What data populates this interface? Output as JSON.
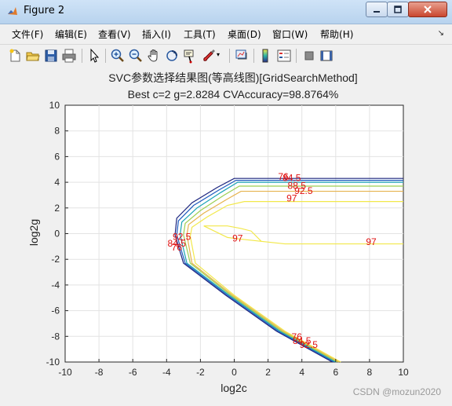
{
  "window": {
    "title": "Figure 2",
    "buttons": {
      "minimize": "minimize",
      "maximize": "maximize",
      "close": "close"
    }
  },
  "menubar": {
    "items": [
      {
        "label": "文件",
        "key": "(F)"
      },
      {
        "label": "编辑",
        "key": "(E)"
      },
      {
        "label": "查看",
        "key": "(V)"
      },
      {
        "label": "插入",
        "key": "(I)"
      },
      {
        "label": "工具",
        "key": "(T)"
      },
      {
        "label": "桌面",
        "key": "(D)"
      },
      {
        "label": "窗口",
        "key": "(W)"
      },
      {
        "label": "帮助",
        "key": "(H)"
      }
    ]
  },
  "toolbar": {
    "icons": [
      "new-figure-icon",
      "open-file-icon",
      "save-icon",
      "print-icon",
      "pointer-icon",
      "zoom-in-icon",
      "zoom-out-icon",
      "pan-hand-icon",
      "rotate-3d-icon",
      "data-cursor-icon",
      "brush-icon",
      "brush-dropdown-icon",
      "link-plot-icon",
      "colorbar-icon",
      "legend-icon",
      "hide-plot-tools-icon",
      "show-plot-tools-icon"
    ]
  },
  "chart_data": {
    "type": "contour",
    "title": "SVC参数选择结果图(等高线图)[GridSearchMethod]",
    "subtitle": "Best c=2 g=2.8284 CVAccuracy=98.8764%",
    "xlabel": "log2c",
    "ylabel": "log2g",
    "xlim": [
      -10,
      10
    ],
    "ylim": [
      -10,
      10
    ],
    "xticks": [
      -10,
      -8,
      -6,
      -4,
      -2,
      0,
      2,
      4,
      6,
      8,
      10
    ],
    "yticks": [
      -10,
      -8,
      -6,
      -4,
      -2,
      0,
      2,
      4,
      6,
      8,
      10
    ],
    "grid": true,
    "contour_lines": [
      {
        "level": 76,
        "color": "#1a237e",
        "points": [
          [
            -3.5,
            -0.1
          ],
          [
            -3.4,
            1.2
          ],
          [
            -2.5,
            2.4
          ],
          [
            -1.0,
            3.6
          ],
          [
            0.0,
            4.3
          ],
          [
            10,
            4.3
          ]
        ],
        "lower": [
          [
            -3.5,
            -0.1
          ],
          [
            -3.0,
            -2.3
          ],
          [
            -0.5,
            -4.8
          ],
          [
            2.5,
            -7.6
          ],
          [
            5.8,
            -10
          ]
        ]
      },
      {
        "level": 84.5,
        "color": "#1e5bbf",
        "points": [
          [
            -3.4,
            -0.1
          ],
          [
            -3.3,
            1.0
          ],
          [
            -2.4,
            2.2
          ],
          [
            -0.9,
            3.4
          ],
          [
            0.1,
            4.15
          ],
          [
            10,
            4.15
          ]
        ],
        "lower": [
          [
            -3.4,
            -0.1
          ],
          [
            -2.9,
            -2.3
          ],
          [
            -0.4,
            -4.8
          ],
          [
            2.6,
            -7.6
          ],
          [
            5.9,
            -10
          ]
        ]
      },
      {
        "level": 88.5,
        "color": "#1aa3b5",
        "points": [
          [
            -3.2,
            -0.1
          ],
          [
            -3.1,
            0.9
          ],
          [
            -2.2,
            2.0
          ],
          [
            -0.8,
            3.2
          ],
          [
            0.2,
            4.0
          ],
          [
            10,
            4.0
          ]
        ],
        "lower": [
          [
            -3.2,
            -0.1
          ],
          [
            -2.8,
            -2.3
          ],
          [
            -0.3,
            -4.8
          ],
          [
            2.7,
            -7.6
          ],
          [
            6.0,
            -10
          ]
        ]
      },
      {
        "level": 92.5,
        "color": "#9ccf52",
        "points": [
          [
            -3.0,
            -0.1
          ],
          [
            -2.9,
            0.8
          ],
          [
            -2.0,
            1.8
          ],
          [
            -0.6,
            3.0
          ],
          [
            0.3,
            3.7
          ],
          [
            10,
            3.7
          ]
        ],
        "lower": [
          [
            -3.0,
            -0.1
          ],
          [
            -2.6,
            -2.3
          ],
          [
            -0.2,
            -4.8
          ],
          [
            2.8,
            -7.6
          ],
          [
            6.1,
            -10
          ]
        ]
      },
      {
        "level": 95,
        "color": "#e6b34d",
        "points": [
          [
            -2.8,
            -0.1
          ],
          [
            -2.7,
            0.7
          ],
          [
            -1.8,
            1.6
          ],
          [
            -0.4,
            2.7
          ],
          [
            0.4,
            3.3
          ],
          [
            10,
            3.3
          ]
        ],
        "lower": [
          [
            -2.8,
            -0.1
          ],
          [
            -2.5,
            -2.3
          ],
          [
            -0.1,
            -4.8
          ],
          [
            2.9,
            -7.6
          ],
          [
            6.2,
            -10
          ]
        ]
      },
      {
        "level": 97,
        "color": "#f2e84a",
        "points": [
          [
            -2.6,
            -0.2
          ],
          [
            -2.5,
            0.5
          ],
          [
            -1.6,
            1.3
          ],
          [
            -0.4,
            2.2
          ],
          [
            0.6,
            2.5
          ],
          [
            10,
            2.5
          ]
        ],
        "lower": [
          [
            -2.6,
            -0.2
          ],
          [
            -2.3,
            -2.3
          ],
          [
            0.0,
            -4.8
          ],
          [
            3.0,
            -7.6
          ],
          [
            6.3,
            -10
          ]
        ]
      },
      {
        "level": 97,
        "color": "#f2e84a",
        "points": [
          [
            -1.8,
            0.6
          ],
          [
            -0.4,
            0.6
          ],
          [
            0.4,
            0.4
          ],
          [
            1.0,
            0.2
          ],
          [
            1.6,
            -0.6
          ],
          [
            3.0,
            -0.8
          ],
          [
            10,
            -0.8
          ]
        ],
        "lower": [
          [
            -1.8,
            0.6
          ],
          [
            -0.4,
            -0.3
          ],
          [
            0.2,
            -0.4
          ],
          [
            1.6,
            -0.6
          ]
        ]
      }
    ],
    "contour_labels": [
      {
        "text": "76",
        "x": 2.9,
        "y": 4.2
      },
      {
        "text": "84.5",
        "x": 3.4,
        "y": 4.1
      },
      {
        "text": "88.5",
        "x": 3.7,
        "y": 3.5
      },
      {
        "text": "92.5",
        "x": 4.1,
        "y": 3.1
      },
      {
        "text": "97",
        "x": 3.4,
        "y": 2.5
      },
      {
        "text": "97",
        "x": 0.2,
        "y": -0.6
      },
      {
        "text": "97",
        "x": 8.1,
        "y": -0.9
      },
      {
        "text": "92.5",
        "x": -3.1,
        "y": -0.5
      },
      {
        "text": "84.5",
        "x": -3.4,
        "y": -1.0
      },
      {
        "text": "76",
        "x": -3.4,
        "y": -1.3
      },
      {
        "text": "76",
        "x": 3.7,
        "y": -8.3
      },
      {
        "text": "84.5",
        "x": 4.0,
        "y": -8.6
      },
      {
        "text": "92.5",
        "x": 4.4,
        "y": -8.9
      }
    ]
  },
  "watermark": "CSDN @mozun2020"
}
